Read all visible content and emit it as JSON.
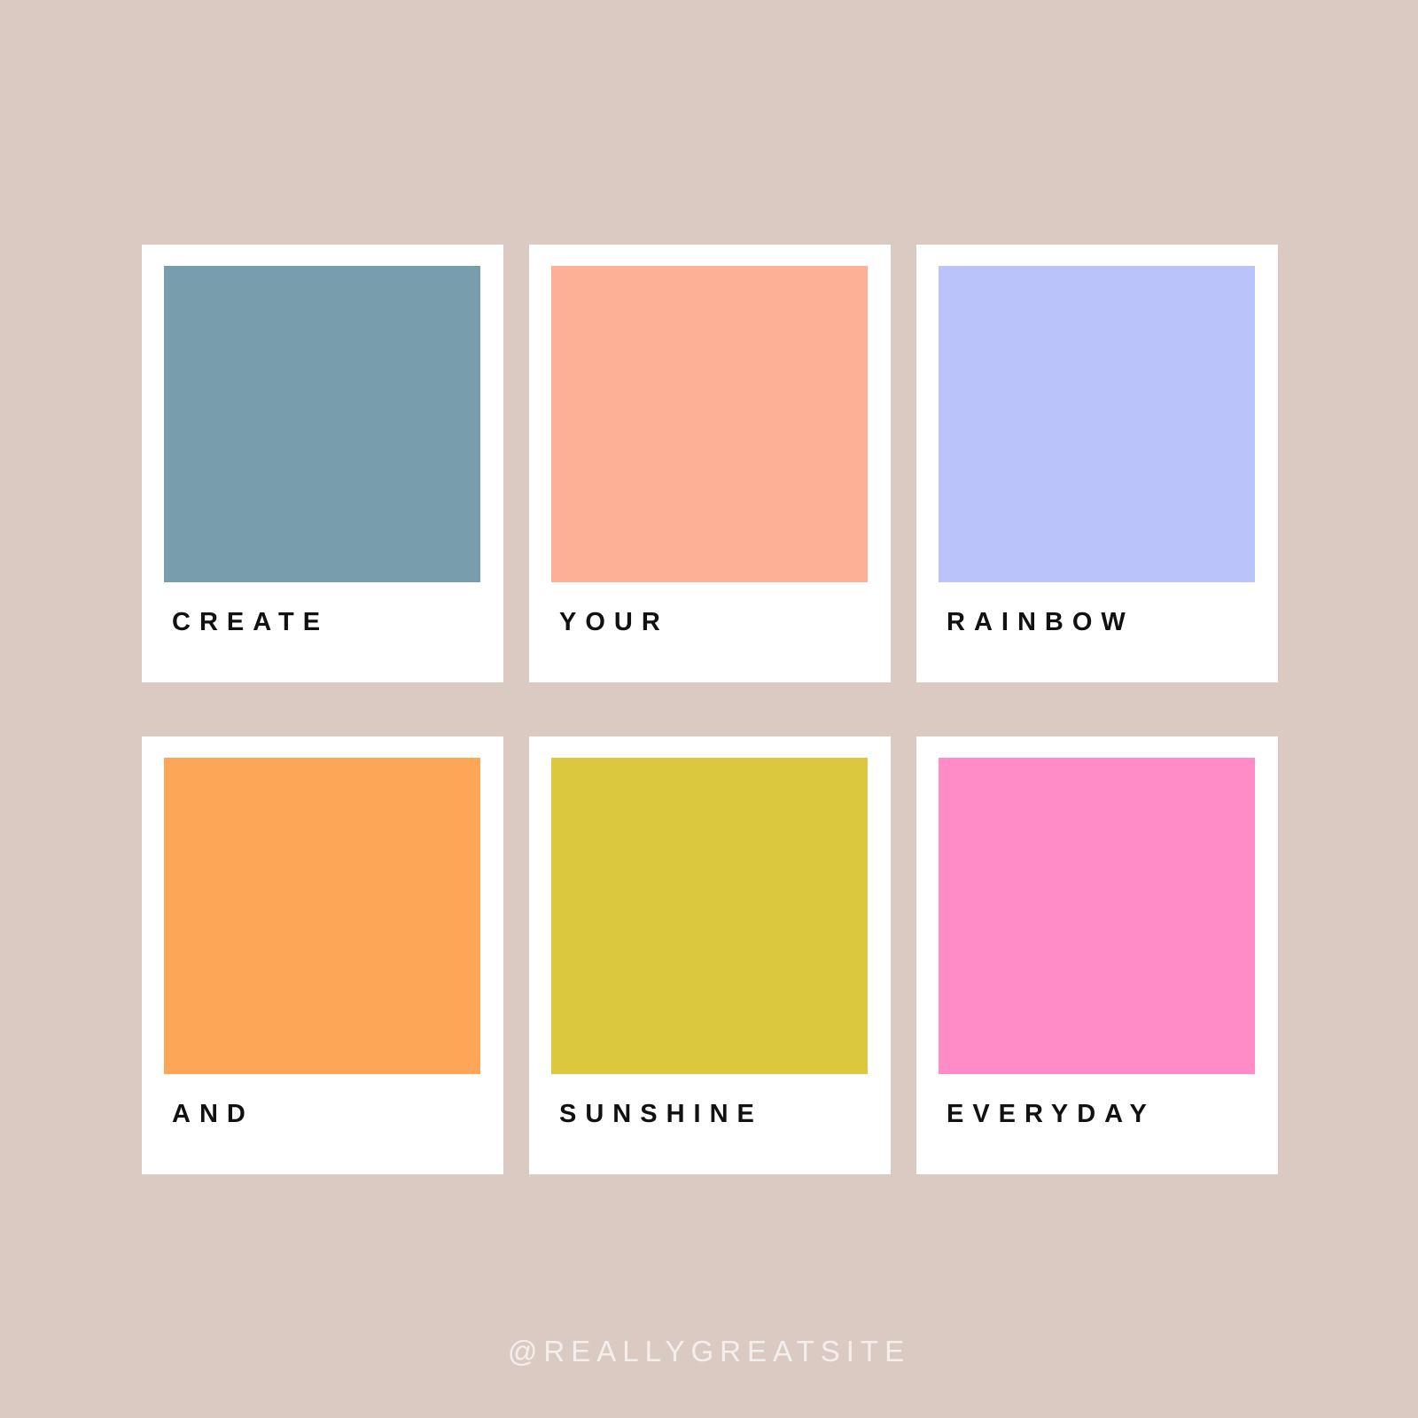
{
  "background": "#dbcac1",
  "cards": [
    {
      "label": "CREATE",
      "color": "#789ead"
    },
    {
      "label": "YOUR",
      "color": "#fdb095"
    },
    {
      "label": "RAINBOW",
      "color": "#bbc4fa"
    },
    {
      "label": "AND",
      "color": "#fea658"
    },
    {
      "label": "SUNSHINE",
      "color": "#dbc83f"
    },
    {
      "label": "EVERYDAY",
      "color": "#ff8bc7"
    }
  ],
  "handle": "@REALLYGREATSITE"
}
